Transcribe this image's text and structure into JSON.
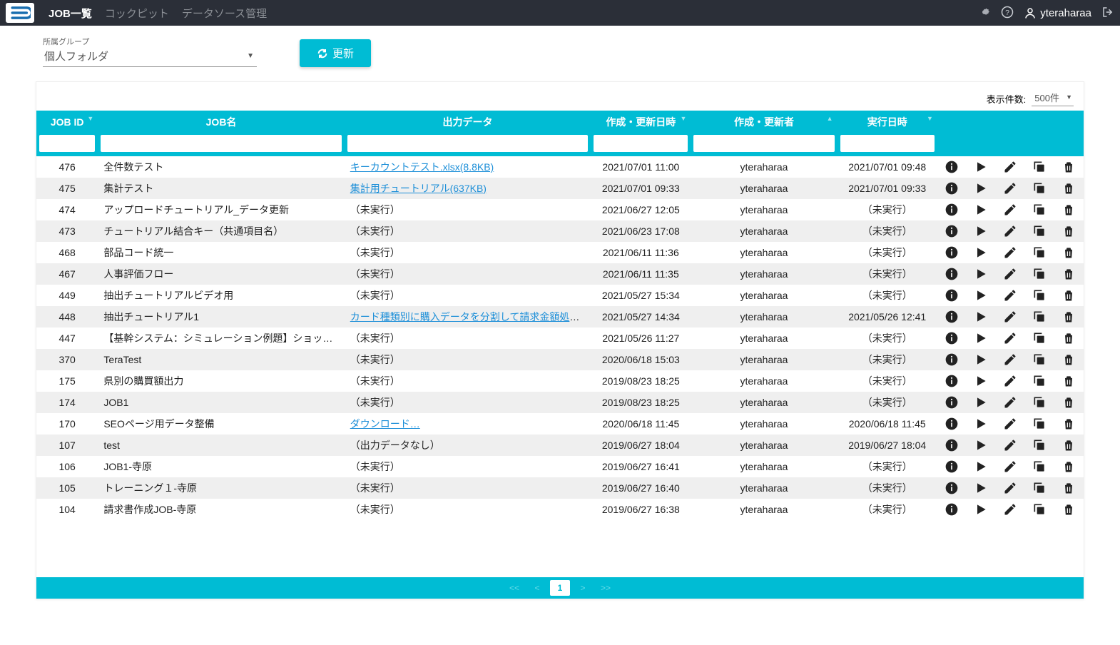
{
  "nav": {
    "items": [
      "JOB一覧",
      "コックピット",
      "データソース管理"
    ],
    "user": "yteraharaa"
  },
  "filter": {
    "group_label": "所属グループ",
    "group_value": "個人フォルダ",
    "refresh": "更新"
  },
  "table": {
    "page_size_label": "表示件数:",
    "page_size_value": "500件",
    "headers": {
      "id": "JOB ID",
      "name": "JOB名",
      "output": "出力データ",
      "updated": "作成・更新日時",
      "updater": "作成・更新者",
      "run": "実行日時"
    },
    "rows": [
      {
        "id": "476",
        "name": "全件数テスト",
        "output": "キーカウントテスト.xlsx(8.8KB)",
        "output_link": true,
        "updated": "2021/07/01 11:00",
        "user": "yteraharaa",
        "run": "2021/07/01 09:48"
      },
      {
        "id": "475",
        "name": "集計テスト",
        "output": "集計用チュートリアル(637KB)",
        "output_link": true,
        "updated": "2021/07/01 09:33",
        "user": "yteraharaa",
        "run": "2021/07/01 09:33"
      },
      {
        "id": "474",
        "name": "アップロードチュートリアル_データ更新",
        "output": "（未実行）",
        "output_link": false,
        "updated": "2021/06/27 12:05",
        "user": "yteraharaa",
        "run": "（未実行）"
      },
      {
        "id": "473",
        "name": "チュートリアル結合キー（共通項目名）",
        "output": "（未実行）",
        "output_link": false,
        "updated": "2021/06/23 17:08",
        "user": "yteraharaa",
        "run": "（未実行）"
      },
      {
        "id": "468",
        "name": "部品コード統一",
        "output": "（未実行）",
        "output_link": false,
        "updated": "2021/06/11 11:36",
        "user": "yteraharaa",
        "run": "（未実行）"
      },
      {
        "id": "467",
        "name": "人事評価フロー",
        "output": "（未実行）",
        "output_link": false,
        "updated": "2021/06/11 11:35",
        "user": "yteraharaa",
        "run": "（未実行）"
      },
      {
        "id": "449",
        "name": "抽出チュートリアルビデオ用",
        "output": "（未実行）",
        "output_link": false,
        "updated": "2021/05/27 15:34",
        "user": "yteraharaa",
        "run": "（未実行）"
      },
      {
        "id": "448",
        "name": "抽出チュートリアル1",
        "output": "カード種類別に購入データを分割して請求金額処理…",
        "output_link": true,
        "updated": "2021/05/27 14:34",
        "user": "yteraharaa",
        "run": "2021/05/26 12:41"
      },
      {
        "id": "447",
        "name": "【基幹システム：シミュレーション例題】ショッピ…",
        "output": "（未実行）",
        "output_link": false,
        "updated": "2021/05/26 11:27",
        "user": "yteraharaa",
        "run": "（未実行）"
      },
      {
        "id": "370",
        "name": "TeraTest",
        "output": "（未実行）",
        "output_link": false,
        "updated": "2020/06/18 15:03",
        "user": "yteraharaa",
        "run": "（未実行）"
      },
      {
        "id": "175",
        "name": "県別の購買額出力",
        "output": "（未実行）",
        "output_link": false,
        "updated": "2019/08/23 18:25",
        "user": "yteraharaa",
        "run": "（未実行）"
      },
      {
        "id": "174",
        "name": "JOB1",
        "output": "（未実行）",
        "output_link": false,
        "updated": "2019/08/23 18:25",
        "user": "yteraharaa",
        "run": "（未実行）"
      },
      {
        "id": "170",
        "name": "SEOページ用データ整備",
        "output": "ダウンロード…",
        "output_link": true,
        "updated": "2020/06/18 11:45",
        "user": "yteraharaa",
        "run": "2020/06/18 11:45"
      },
      {
        "id": "107",
        "name": "test",
        "output": "（出力データなし）",
        "output_link": false,
        "updated": "2019/06/27 18:04",
        "user": "yteraharaa",
        "run": "2019/06/27 18:04"
      },
      {
        "id": "106",
        "name": "JOB1-寺原",
        "output": "（未実行）",
        "output_link": false,
        "updated": "2019/06/27 16:41",
        "user": "yteraharaa",
        "run": "（未実行）"
      },
      {
        "id": "105",
        "name": "トレーニング１-寺原",
        "output": "（未実行）",
        "output_link": false,
        "updated": "2019/06/27 16:40",
        "user": "yteraharaa",
        "run": "（未実行）"
      },
      {
        "id": "104",
        "name": "請求書作成JOB-寺原",
        "output": "（未実行）",
        "output_link": false,
        "updated": "2019/06/27 16:38",
        "user": "yteraharaa",
        "run": "（未実行）"
      }
    ]
  },
  "pager": {
    "first": "<<",
    "prev": "<",
    "current": "1",
    "next": ">",
    "last": ">>"
  }
}
